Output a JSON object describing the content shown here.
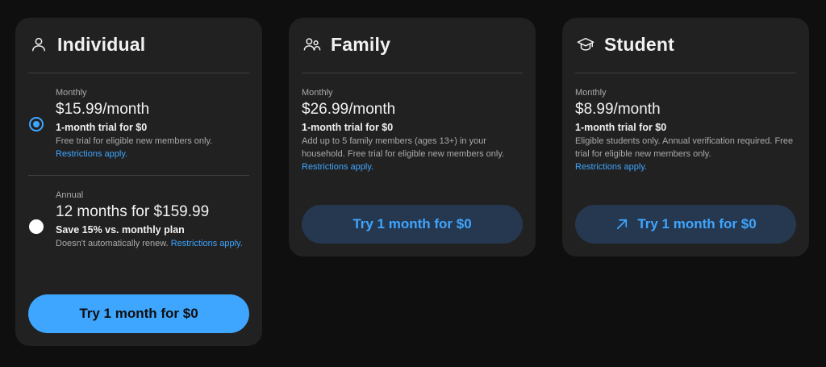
{
  "colors": {
    "background": "#0f0f0f",
    "card": "#212121",
    "accent": "#3ea6ff",
    "secondary_button": "#263850"
  },
  "individual": {
    "icon": "person-icon",
    "title": "Individual",
    "monthly": {
      "period": "Monthly",
      "price": "$15.99/month",
      "trial": "1-month trial for $0",
      "desc": "Free trial for eligible new members only.",
      "link": "Restrictions apply.",
      "selected": true
    },
    "annual": {
      "period": "Annual",
      "price": "12 months for $159.99",
      "trial": "Save 15% vs. monthly plan",
      "desc": "Doesn't automatically renew.",
      "link": "Restrictions apply.",
      "selected": false
    },
    "button": "Try 1 month for $0"
  },
  "family": {
    "icon": "people-icon",
    "title": "Family",
    "period": "Monthly",
    "price": "$26.99/month",
    "trial": "1-month trial for $0",
    "desc": "Add up to 5 family members (ages 13+) in your household. Free trial for eligible new members only.",
    "link": "Restrictions apply.",
    "button": "Try 1 month for $0"
  },
  "student": {
    "icon": "graduation-cap-icon",
    "title": "Student",
    "period": "Monthly",
    "price": "$8.99/month",
    "trial": "1-month trial for $0",
    "desc": "Eligible students only. Annual verification required. Free trial for eligible new members only.",
    "link": "Restrictions apply.",
    "button_icon": "external-link-arrow-icon",
    "button": "Try 1 month for $0"
  }
}
